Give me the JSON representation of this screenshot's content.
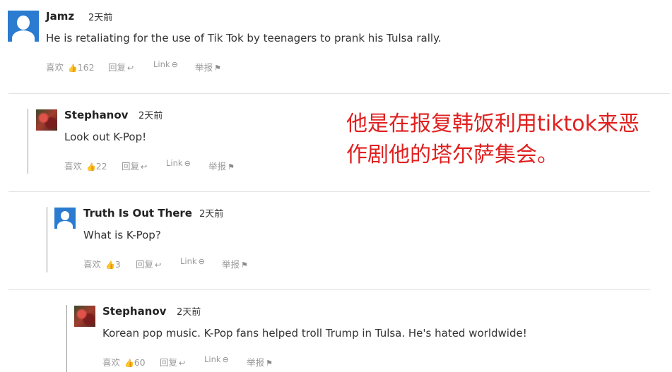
{
  "comments": [
    {
      "author": "Jamz",
      "time": "2天前",
      "text": "He is retaliating for the use of Tik Tok by teenagers to prank his Tulsa rally.",
      "like_label": "喜欢",
      "likes": "162",
      "reply_label": "回复",
      "link_label": "Link",
      "report_label": "举报"
    },
    {
      "author": "Stephanov",
      "time": "2天前",
      "text": "Look out K-Pop!",
      "like_label": "喜欢",
      "likes": "22",
      "reply_label": "回复",
      "link_label": "Link",
      "report_label": "举报"
    },
    {
      "author": "Truth Is Out There",
      "time": "2天前",
      "text": "What is K-Pop?",
      "like_label": "喜欢",
      "likes": "3",
      "reply_label": "回复",
      "link_label": "Link",
      "report_label": "举报"
    },
    {
      "author": "Stephanov",
      "time": "2天前",
      "text": "Korean pop music. K-Pop fans helped troll Trump in Tulsa. He's hated worldwide!",
      "like_label": "喜欢",
      "likes": "60",
      "reply_label": "回复",
      "link_label": "Link",
      "report_label": "举报"
    }
  ],
  "overlay": {
    "line1": "他是在报复韩饭利用tiktok来恶",
    "line2": "作剧他的塔尔萨集会。",
    "color": "#e02020"
  },
  "icons": {
    "like": "thumbs-up-icon",
    "reply": "reply-arrow-icon",
    "link": "link-icon",
    "report": "flag-icon"
  }
}
